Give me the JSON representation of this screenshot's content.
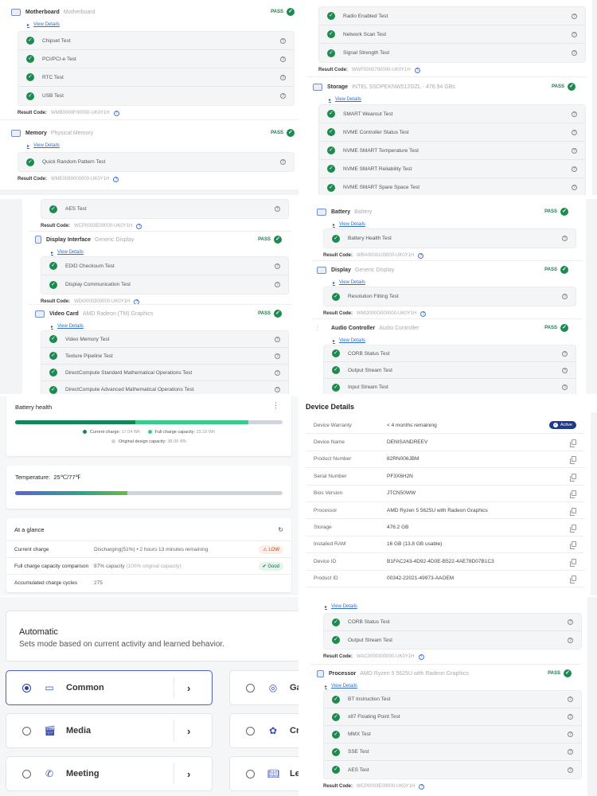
{
  "panel1": {
    "sections": [
      {
        "title": "Motherboard",
        "subtitle": "Motherboard",
        "status": "PASS",
        "view_details": "View Details",
        "tests": [
          "Chipset Test",
          "PCI/PCI-e Test",
          "RTC Test",
          "USB Test"
        ],
        "result_label": "Result Code:",
        "result_code": "WMB0000F00000-UK0Y1H"
      },
      {
        "title": "Memory",
        "subtitle": "Physical Memory",
        "status": "PASS",
        "view_details": "View Details",
        "tests": [
          "Quick Random Pattern Test"
        ],
        "result_label": "Result Code:",
        "result_code": "WME0080000000-UK0Y1H"
      }
    ]
  },
  "panel2": {
    "wifi": {
      "tests": [
        "Radio Enabled Test",
        "Network Scan Test",
        "Signal Strength Test"
      ],
      "result_label": "Result Code:",
      "result_code": "WWF0000700000-UK0Y1H"
    },
    "storage": {
      "title": "Storage",
      "subtitle": "INTEL SSDPEKNW512GZL - 476.94 GBs",
      "status": "PASS",
      "view_details": "View Details",
      "tests": [
        "SMART Wearout Test",
        "NVME Controller Status Test",
        "NVME SMART Temperature Test",
        "NVME SMART Reliability Test",
        "NVME SMART Spare Space Test"
      ]
    }
  },
  "panel3": {
    "processor_tail": {
      "tests": [
        "AES Test"
      ],
      "result_label": "Result Code:",
      "result_code": "WCP0003E00000-UK0Y1H"
    },
    "display_interface": {
      "title": "Display Interface",
      "subtitle": "Generic Display",
      "status": "PASS",
      "view_details": "View Details",
      "tests": [
        "EDID Checksum Test",
        "Display Communication Test"
      ],
      "result_label": "Result Code:",
      "result_code": "WDI0000300000-UK0Y1H"
    },
    "video_card": {
      "title": "Video Card",
      "subtitle": "AMD Radeon (TM) Graphics",
      "status": "PASS",
      "view_details": "View Details",
      "tests": [
        "Video Memory Test",
        "Texture Pipeline Test",
        "DirectCompute Standard Mathematical Operations Test",
        "DirectCompute Advanced Mathematical Operations Test"
      ]
    }
  },
  "panel4": {
    "battery": {
      "title": "Battery",
      "subtitle": "Battery",
      "status": "PASS",
      "view_details": "View Details",
      "tests": [
        "Battery Health Test"
      ],
      "result_label": "Result Code:",
      "result_code": "WBA0000100000-UK0Y1H"
    },
    "display": {
      "title": "Display",
      "subtitle": "Generic Display",
      "status": "PASS",
      "view_details": "View Details",
      "tests": [
        "Resolution Fitting Test"
      ],
      "result_label": "Result Code:",
      "result_code": "WMO000G000000-UK0Y1H"
    },
    "audio": {
      "title": "Audio Controller",
      "subtitle": "Audio Controller",
      "status": "PASS",
      "view_details": "View Details",
      "tests": [
        "CORB Status Test",
        "Output Stream Test",
        "Input Stream Test"
      ]
    }
  },
  "battery_health": {
    "title": "Battery health",
    "current_charge_wh": 17.04,
    "full_charge_capacity_wh": 33.16,
    "design_capacity_wh": 38.0,
    "legend": {
      "current_label": "Current charge:",
      "current_value": "17.04 Wh",
      "full_label": "Full charge capacity:",
      "full_value": "33.16 Wh",
      "design_label": "Original design capacity:",
      "design_value": "38.00 Wh"
    },
    "colors": {
      "current": "#13875a",
      "full": "#3ccb8f",
      "design": "#cfd4dd"
    }
  },
  "temperature": {
    "label": "Temperature:",
    "value": "25℃/77℉",
    "fill_fraction": 0.42
  },
  "glance": {
    "title": "At a glance",
    "rows": [
      {
        "label": "Current charge",
        "value": "Discharging(51%)  •  2 hours 13 minutes remaining",
        "muted": "",
        "badge": "LOW",
        "badge_type": "low"
      },
      {
        "label": "Full charge capacity comparison",
        "value": "87% capacity ",
        "muted": "(100% original capacity)",
        "badge": "Good",
        "badge_type": "good"
      },
      {
        "label": "Accumulated charge cycles",
        "value": "275",
        "muted": "",
        "badge": "",
        "badge_type": ""
      }
    ]
  },
  "device_details": {
    "title": "Device Details",
    "rows": [
      {
        "key": "Device Warranty",
        "value": "< 4 months remaining",
        "badge": "Active"
      },
      {
        "key": "Device Name",
        "value": "DENISANDREEV"
      },
      {
        "key": "Product Number",
        "value": "82RN006JBM"
      },
      {
        "key": "Serial Number",
        "value": "PF3X6H2N"
      },
      {
        "key": "Bios Version",
        "value": "JTCN50WW"
      },
      {
        "key": "Processor",
        "value": "AMD Ryzen 5 5625U with Radeon Graphics"
      },
      {
        "key": "Storage",
        "value": "476.2 GB"
      },
      {
        "key": "Installed RAM",
        "value": "16 GB (13.8 GB usable)"
      },
      {
        "key": "Device ID",
        "value": "B1FAC243-4D92-4D0E-B522-4AE78D07B1C3"
      },
      {
        "key": "Product ID",
        "value": "00342-22021-49973-AAOEM"
      }
    ]
  },
  "modes": {
    "automatic_title": "Automatic",
    "automatic_desc": "Sets mode based on current activity and learned behavior.",
    "items": [
      {
        "label": "Common",
        "selected": true
      },
      {
        "label": "Ga",
        "selected": false
      },
      {
        "label": "Media",
        "selected": false
      },
      {
        "label": "Cre",
        "selected": false
      },
      {
        "label": "Meeting",
        "selected": false
      },
      {
        "label": "Lea",
        "selected": false
      }
    ]
  },
  "panel8": {
    "audio_tail": {
      "view_details": "View Details",
      "tests": [
        "CORB Status Test",
        "Output Stream Test"
      ],
      "result_label": "Result Code:",
      "result_code": "WAC0000300000-UK0Y1H"
    },
    "processor": {
      "title": "Processor",
      "subtitle": "AMD Ryzen 5 5625U with Radeon Graphics",
      "status": "PASS",
      "view_details": "View Details",
      "tests": [
        "BT Instruction Test",
        "x87 Floating Point Test",
        "MMX Test",
        "SSE Test",
        "AES Test"
      ],
      "result_label": "Result Code:",
      "result_code": "WCP0003E00000-UK0Y1H"
    }
  }
}
